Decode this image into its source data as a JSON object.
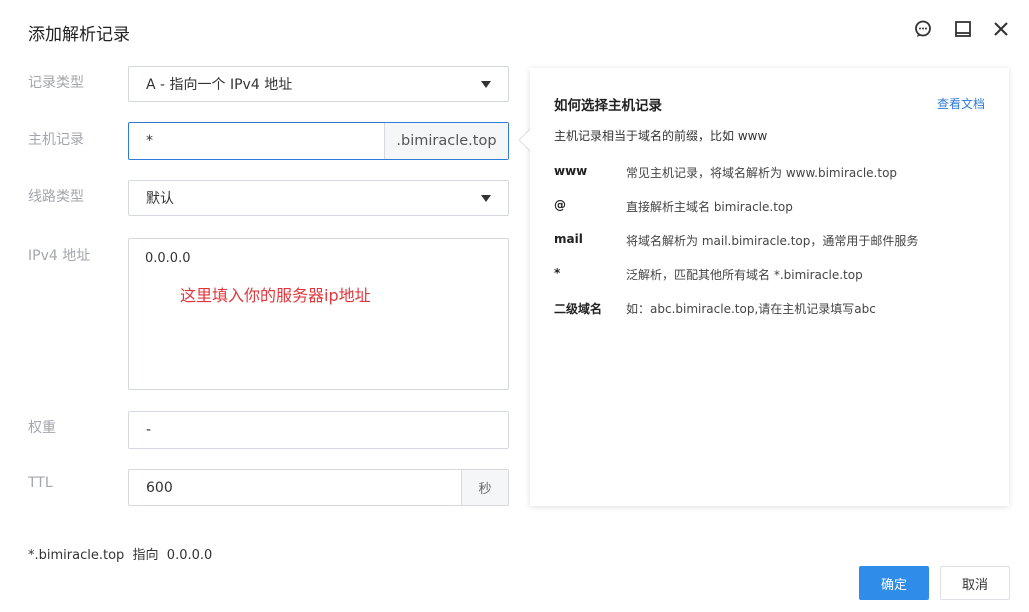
{
  "dialog": {
    "title": "添加解析记录"
  },
  "form": {
    "record_type": {
      "label": "记录类型",
      "value": "A - 指向一个 IPv4 地址"
    },
    "host": {
      "label": "主机记录",
      "value": "*",
      "suffix": ".bimiracle.top"
    },
    "line": {
      "label": "线路类型",
      "value": "默认"
    },
    "ipv4": {
      "label": "IPv4 地址",
      "value": "0.0.0.0",
      "annotation": "这里填入你的服务器ip地址"
    },
    "weight": {
      "label": "权重",
      "value": "-"
    },
    "ttl": {
      "label": "TTL",
      "value": "600",
      "unit": "秒"
    }
  },
  "help": {
    "title": "如何选择主机记录",
    "link": "查看文档",
    "desc": "主机记录相当于域名的前缀，比如 www",
    "rows": [
      {
        "key": "www",
        "value": "常见主机记录，将域名解析为 www.bimiracle.top"
      },
      {
        "key": "@",
        "value": "直接解析主域名 bimiracle.top"
      },
      {
        "key": "mail",
        "value": "将域名解析为 mail.bimiracle.top，通常用于邮件服务"
      },
      {
        "key": "*",
        "value": "泛解析，匹配其他所有域名 *.bimiracle.top"
      },
      {
        "key": "二级域名",
        "value": "如：abc.bimiracle.top,请在主机记录填写abc"
      }
    ]
  },
  "summary": "*.bimiracle.top  指向  0.0.0.0",
  "buttons": {
    "ok": "确定",
    "cancel": "取消"
  },
  "colors": {
    "accent": "#2f8ce8",
    "annotation": "#e0373b",
    "focus_border": "#2f7bd9"
  },
  "icons": {
    "header": [
      "feedback-icon",
      "maximize-icon",
      "close-icon"
    ],
    "dropdown": "caret-down-icon"
  }
}
